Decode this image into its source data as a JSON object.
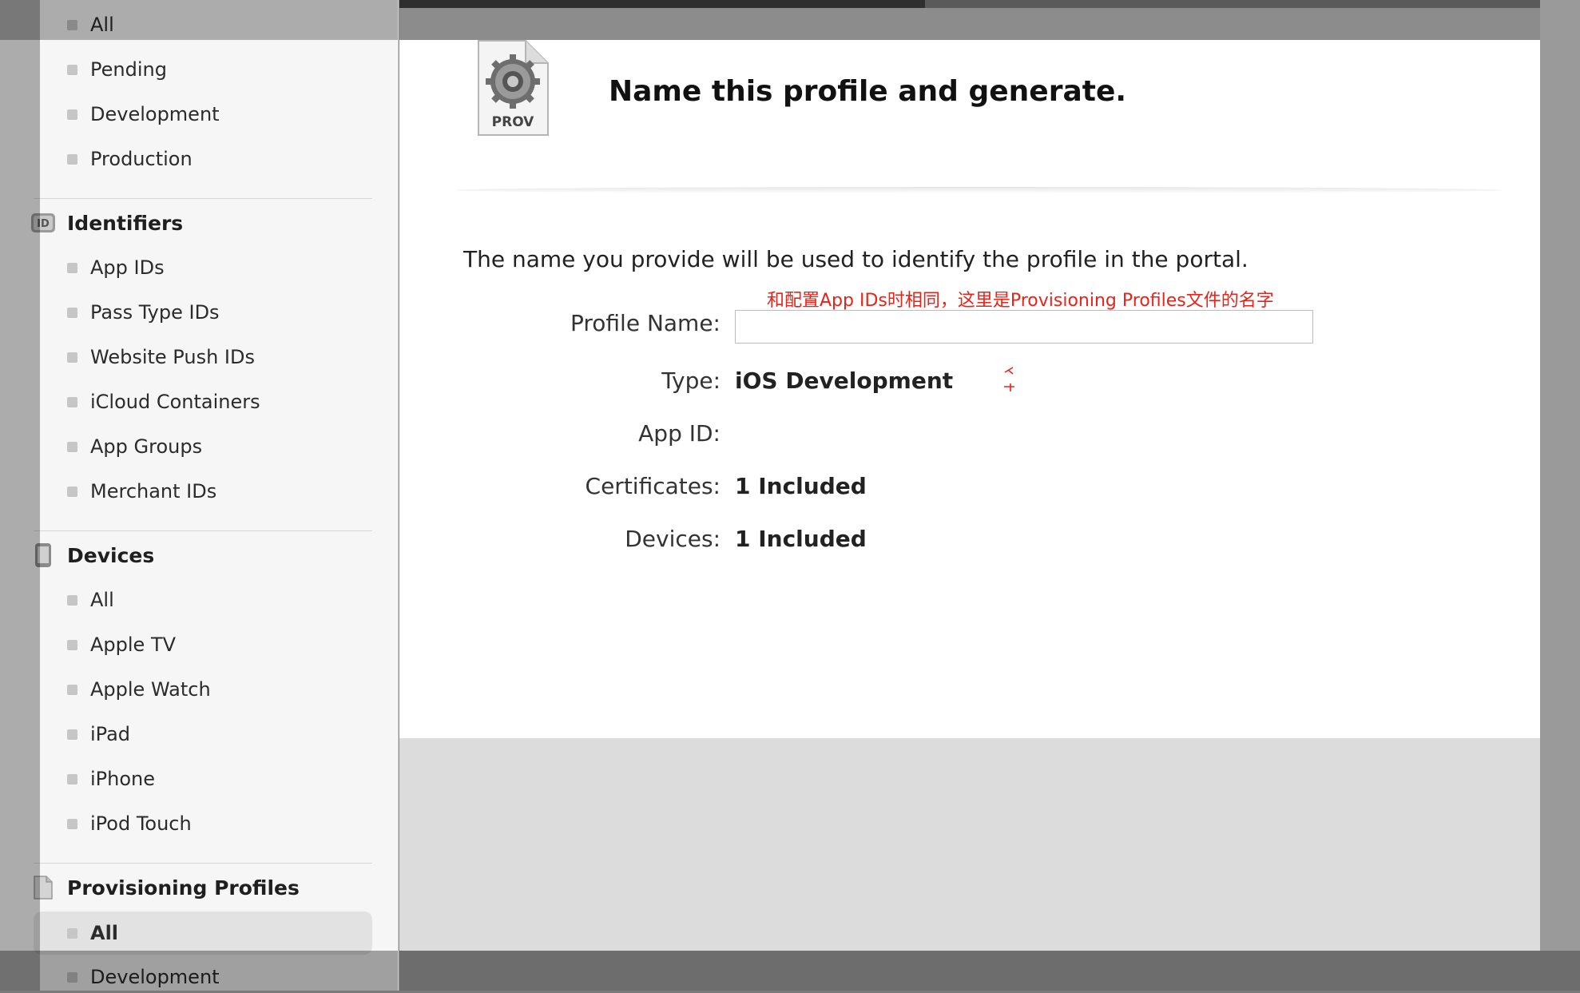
{
  "sidebar": {
    "certificates_items": [
      {
        "label": "All"
      },
      {
        "label": "Pending"
      },
      {
        "label": "Development"
      },
      {
        "label": "Production"
      }
    ],
    "identifiers": {
      "title": "Identifiers",
      "icon": "id-badge-icon",
      "items": [
        {
          "label": "App IDs"
        },
        {
          "label": "Pass Type IDs"
        },
        {
          "label": "Website Push IDs"
        },
        {
          "label": "iCloud Containers"
        },
        {
          "label": "App Groups"
        },
        {
          "label": "Merchant IDs"
        }
      ]
    },
    "devices": {
      "title": "Devices",
      "icon": "iphone-device-icon",
      "items": [
        {
          "label": "All"
        },
        {
          "label": "Apple TV"
        },
        {
          "label": "Apple Watch"
        },
        {
          "label": "iPad"
        },
        {
          "label": "iPhone"
        },
        {
          "label": "iPod Touch"
        }
      ]
    },
    "provisioning": {
      "title": "Provisioning Profiles",
      "icon": "document-icon",
      "items": [
        {
          "label": "All",
          "selected": true
        },
        {
          "label": "Development"
        }
      ]
    }
  },
  "main": {
    "icon_label": "PROV",
    "heading": "Name this profile and generate.",
    "description": "The name you provide will be used to identify the profile in the portal.",
    "annotation": "和配置App IDs时相同，这里是Provisioning Profiles文件的名字",
    "annotation_color": "#e8231a",
    "fields": {
      "profile_name": {
        "label": "Profile Name:",
        "value": "",
        "placeholder": ""
      },
      "type": {
        "label": "Type:",
        "value": "iOS Development"
      },
      "app_id": {
        "label": "App ID:",
        "value": ""
      },
      "certificates": {
        "label": "Certificates:",
        "value": "1 Included"
      },
      "devices": {
        "label": "Devices:",
        "value": "1 Included"
      }
    }
  }
}
